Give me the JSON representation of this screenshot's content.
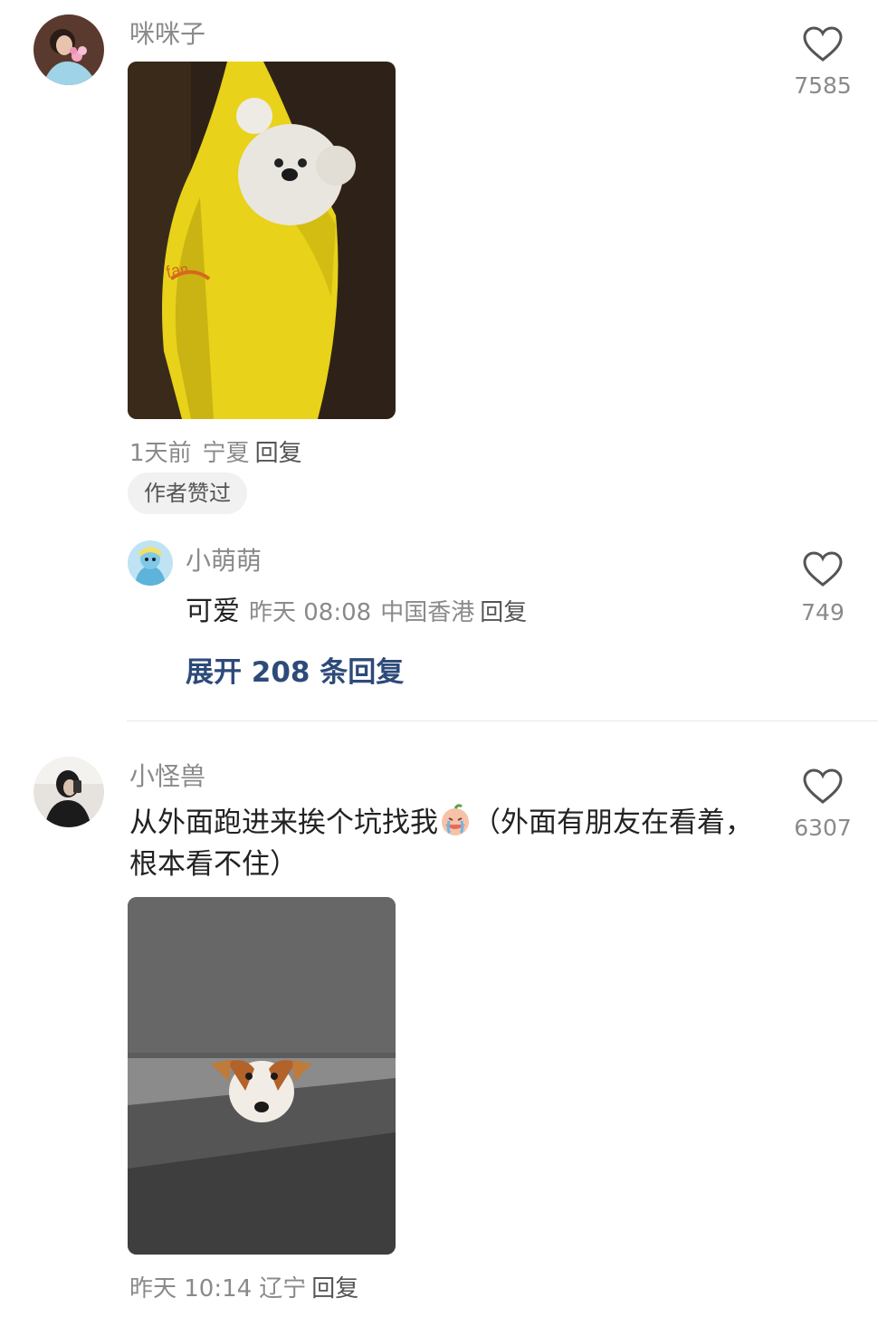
{
  "comments": [
    {
      "username": "咪咪子",
      "like_count": "7585",
      "time": "1天前",
      "region": "宁夏",
      "reply_label": "回复",
      "badge": "作者赞过",
      "sub_reply": {
        "username": "小萌萌",
        "text": "可爱",
        "time": "昨天 08:08",
        "region": "中国香港",
        "reply_label": "回复",
        "like_count": "749"
      },
      "expand_label": "展开 208 条回复"
    },
    {
      "username": "小怪兽",
      "like_count": "6307",
      "text_before_emoji": "从外面跑进来挨个坑找我",
      "text_after_emoji": "（外面有朋友在看着，根本看不住）",
      "time": "昨天 10:14",
      "region": "辽宁",
      "reply_label": "回复"
    }
  ],
  "icons": {
    "like": "heart-outline-icon",
    "emoji": "crying-face-emoji"
  },
  "colors": {
    "secondary_text": "#8a8a8a",
    "expand_link": "#2e4a7a",
    "badge_bg": "#f1f1f1"
  }
}
